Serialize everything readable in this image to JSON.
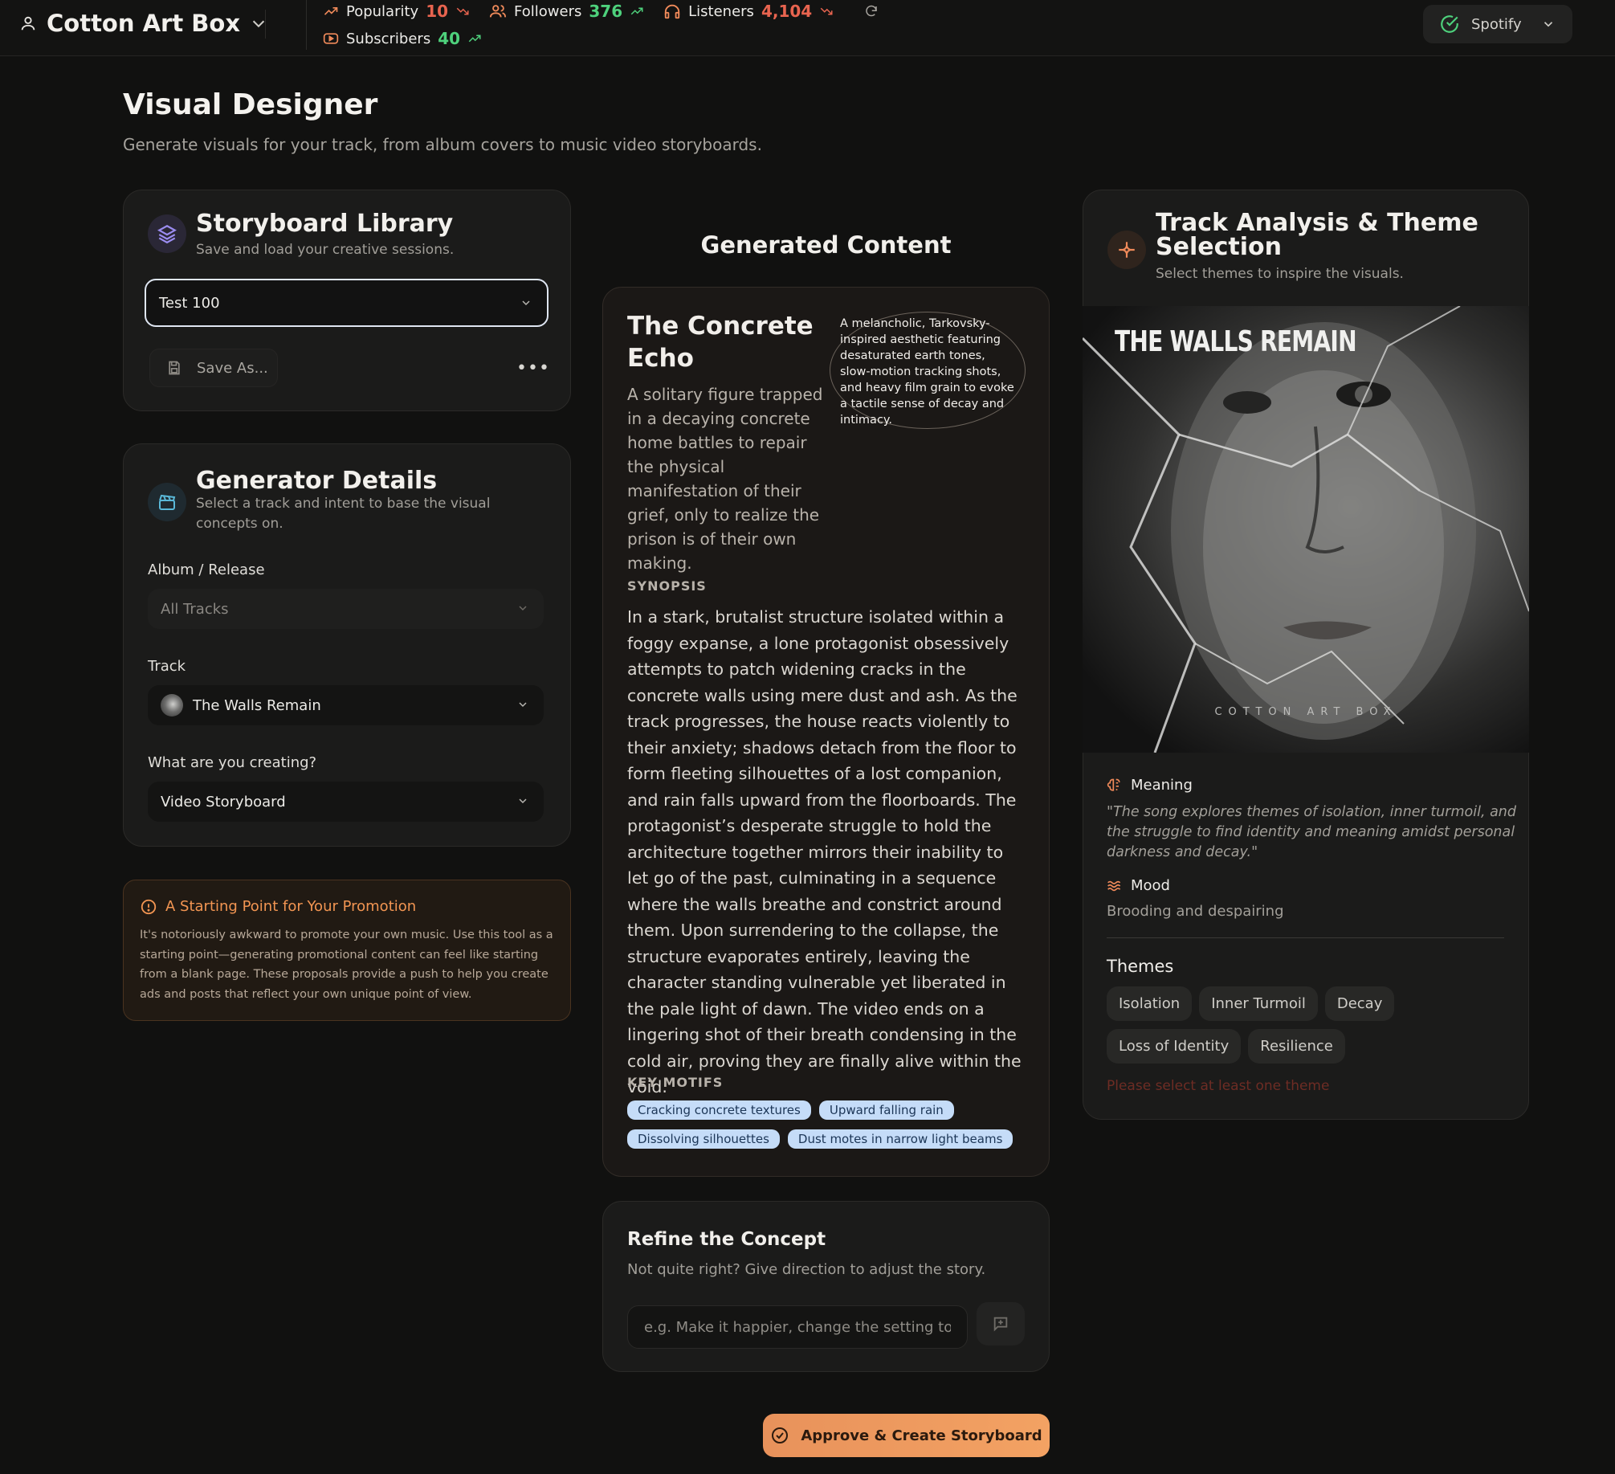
{
  "header": {
    "artist_name": "Cotton Art Box",
    "stats": [
      {
        "label": "Popularity",
        "value": "10",
        "trend": "down"
      },
      {
        "label": "Followers",
        "value": "376",
        "trend": "up"
      },
      {
        "label": "Listeners",
        "value": "4,104",
        "trend": "down"
      },
      {
        "label": "Subscribers",
        "value": "40",
        "trend": "up"
      }
    ],
    "platform": "Spotify"
  },
  "page": {
    "title": "Visual Designer",
    "subtitle": "Generate visuals for your track, from album covers to music video storyboards."
  },
  "library": {
    "title": "Storyboard Library",
    "subtitle": "Save and load your creative sessions.",
    "selected": "Test 100",
    "save_label": "Save As..."
  },
  "generator": {
    "title": "Generator Details",
    "subtitle": "Select a track and intent to base the visual concepts on.",
    "album_label": "Album / Release",
    "album_value": "All Tracks",
    "track_label": "Track",
    "track_value": "The Walls Remain",
    "intent_label": "What are you creating?",
    "intent_value": "Video Storyboard"
  },
  "notice": {
    "title": "A Starting Point for Your Promotion",
    "body": "It's notoriously awkward to promote your own music. Use this tool as a starting point—generating promotional content can feel like starting from a blank page. These proposals provide a push to help you create ads and posts that reflect your own unique point of view."
  },
  "content": {
    "heading": "Generated Content",
    "title": "The Concrete Echo",
    "logline": "A solitary figure trapped in a decaying concrete home battles to repair the physical manifestation of their grief, only to realize the prison is of their own making.",
    "aesthetic": "A melancholic, Tarkovsky-inspired aesthetic featuring desaturated earth tones, slow-motion tracking shots, and heavy film grain to evoke a tactile sense of decay and intimacy.",
    "synopsis_label": "SYNOPSIS",
    "synopsis": "In a stark, brutalist structure isolated within a foggy expanse, a lone protagonist obsessively attempts to patch widening cracks in the concrete walls using mere dust and ash. As the track progresses, the house reacts violently to their anxiety; shadows detach from the floor to form fleeting silhouettes of a lost companion, and rain falls upward from the floorboards. The protagonist’s desperate struggle to hold the architecture together mirrors their inability to let go of the past, culminating in a sequence where the walls breathe and constrict around them. Upon surrendering to the collapse, the structure evaporates entirely, leaving the character standing vulnerable yet liberated in the pale light of dawn. The video ends on a lingering shot of their breath condensing in the cold air, proving they are finally alive within the void.",
    "motifs_label": "KEY MOTIFS",
    "motifs": [
      "Cracking concrete textures",
      "Upward falling rain",
      "Dissolving silhouettes",
      "Dust motes in narrow light beams"
    ]
  },
  "refine": {
    "title": "Refine the Concept",
    "subtitle": "Not quite right? Give direction to adjust the story.",
    "placeholder": "e.g. Make it happier, change the setting to a forest..."
  },
  "approve_label": "Approve & Create Storyboard",
  "analysis": {
    "title": "Track Analysis & Theme Selection",
    "subtitle": "Select themes to inspire the visuals.",
    "cover_title": "THE WALLS REMAIN",
    "cover_brand": "COTTON ART BOX",
    "meaning_label": "Meaning",
    "meaning": "\"The song explores themes of isolation, inner turmoil, and the struggle to find identity and meaning amidst personal darkness and decay.\"",
    "mood_label": "Mood",
    "mood": "Brooding and despairing",
    "themes_label": "Themes",
    "themes": [
      "Isolation",
      "Inner Turmoil",
      "Decay",
      "Loss of Identity",
      "Resilience"
    ],
    "themes_error": "Please select at least one theme"
  },
  "colors": {
    "accent_orange": "#f3a263",
    "trend_red": "#e8644f",
    "trend_green": "#4ed17c",
    "motif_blue": "#c5dcf8"
  }
}
